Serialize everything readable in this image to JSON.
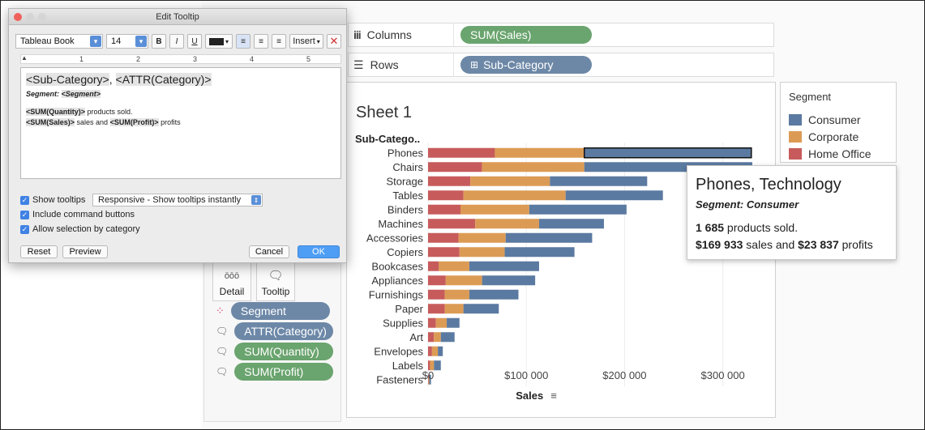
{
  "dialog": {
    "title": "Edit Tooltip",
    "font_name": "Tableau Book",
    "font_size": "14",
    "bold_label": "B",
    "italic_label": "I",
    "underline_label": "U",
    "insert_label": "Insert",
    "ruler_marks": [
      "1",
      "2",
      "3",
      "4",
      "5"
    ],
    "editor": {
      "line1_field1": "<Sub-Category>",
      "line1_sep": ", ",
      "line1_field2": "<ATTR(Category)>",
      "line2_prefix": "Segment: ",
      "line2_field": "<Segment>",
      "line3_field": "<SUM(Quantity)>",
      "line3_text": " products sold.",
      "line4_field1": "<SUM(Sales)>",
      "line4_text1": " sales and ",
      "line4_field2": "<SUM(Profit)>",
      "line4_text2": " profits"
    },
    "show_tooltips": "Show tooltips",
    "tooltip_mode": "Responsive - Show tooltips instantly",
    "include_buttons": "Include command buttons",
    "allow_selection": "Allow selection by category",
    "reset": "Reset",
    "preview": "Preview",
    "cancel": "Cancel",
    "ok": "OK"
  },
  "shelves": {
    "columns_label": "Columns",
    "columns_pill": "SUM(Sales)",
    "rows_label": "Rows",
    "rows_pill": "Sub-Category"
  },
  "marks": {
    "detail": "Detail",
    "tooltip": "Tooltip",
    "pills": [
      "Segment",
      "ATTR(Category)",
      "SUM(Quantity)",
      "SUM(Profit)"
    ]
  },
  "sheet_title": "Sheet 1",
  "legend": {
    "title": "Segment",
    "items": [
      "Consumer",
      "Corporate",
      "Home Office"
    ],
    "colors": [
      "#5b7aa1",
      "#dc9b55",
      "#c75b5b"
    ]
  },
  "tooltip": {
    "title": "Phones, Technology",
    "segment": "Segment: Consumer",
    "qty_value": "1 685",
    "qty_text": " products sold.",
    "sales_value": "$169 933",
    "sales_text": " sales and ",
    "profit_value": "$23 837",
    "profit_text": " profits"
  },
  "chart_data": {
    "type": "bar",
    "orientation": "horizontal",
    "stacked": true,
    "row_header": "Sub-Catego..",
    "xlabel": "Sales",
    "xlim": [
      0,
      330000
    ],
    "x_ticks": [
      "$0",
      "$100 000",
      "$200 000",
      "$300 000"
    ],
    "x_tick_values": [
      0,
      100000,
      200000,
      300000
    ],
    "categories": [
      "Phones",
      "Chairs",
      "Storage",
      "Tables",
      "Binders",
      "Machines",
      "Accessories",
      "Copiers",
      "Bookcases",
      "Appliances",
      "Furnishings",
      "Paper",
      "Supplies",
      "Art",
      "Envelopes",
      "Labels",
      "Fasteners"
    ],
    "series": [
      {
        "name": "Home Office",
        "color": "#c75b5b",
        "values": [
          68000,
          55000,
          43000,
          36000,
          33000,
          48000,
          31000,
          32000,
          11000,
          18000,
          17000,
          17000,
          8000,
          6000,
          4000,
          2000,
          500
        ]
      },
      {
        "name": "Corporate",
        "color": "#dc9b55",
        "values": [
          91000,
          104000,
          81000,
          104000,
          70000,
          65000,
          48000,
          46000,
          31000,
          37000,
          25000,
          19000,
          11000,
          7000,
          6000,
          4000,
          700
        ]
      },
      {
        "name": "Consumer",
        "color": "#5b7aa1",
        "values": [
          170000,
          171000,
          99000,
          99000,
          99000,
          66000,
          88000,
          71000,
          71000,
          54000,
          50000,
          36000,
          13000,
          14000,
          5000,
          7000,
          1800
        ]
      }
    ]
  }
}
